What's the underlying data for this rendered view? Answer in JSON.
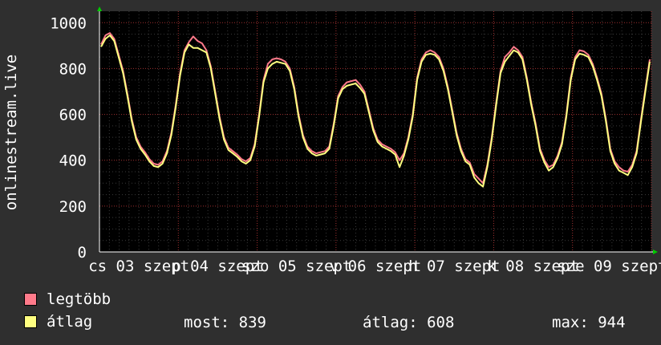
{
  "chart_data": {
    "type": "line",
    "ylabel": "onlinestream.live",
    "ylim": [
      0,
      1050
    ],
    "y_ticks": [
      "0",
      "200",
      "400",
      "600",
      "800",
      "1000"
    ],
    "x_ticks": [
      "cs 03 szept",
      "p 04 szept",
      "szo 05 szept",
      "v 06 szept",
      "h 07 szept",
      "k 08 szept",
      "sze 09 szept"
    ],
    "grid": true,
    "series": [
      {
        "name": "legtöbb",
        "color": "#ff7a8a",
        "values": [
          905,
          945,
          955,
          930,
          860,
          790,
          690,
          580,
          500,
          460,
          435,
          405,
          385,
          380,
          395,
          440,
          520,
          640,
          780,
          880,
          915,
          940,
          920,
          910,
          880,
          810,
          700,
          590,
          500,
          455,
          440,
          425,
          405,
          395,
          410,
          470,
          600,
          750,
          820,
          840,
          845,
          840,
          830,
          800,
          720,
          600,
          510,
          460,
          440,
          430,
          435,
          440,
          460,
          560,
          680,
          720,
          740,
          745,
          750,
          730,
          700,
          620,
          540,
          490,
          470,
          460,
          450,
          435,
          400,
          430,
          500,
          600,
          760,
          840,
          870,
          880,
          870,
          850,
          800,
          720,
          620,
          520,
          450,
          405,
          390,
          340,
          320,
          300,
          380,
          500,
          650,
          790,
          850,
          870,
          895,
          880,
          850,
          760,
          650,
          560,
          450,
          400,
          370,
          380,
          420,
          480,
          600,
          760,
          850,
          880,
          875,
          860,
          820,
          760,
          690,
          580,
          450,
          395,
          370,
          355,
          350,
          380,
          440,
          580,
          710,
          840
        ]
      },
      {
        "name": "átlag",
        "color": "#ffff80",
        "values": [
          895,
          930,
          945,
          920,
          850,
          780,
          680,
          570,
          490,
          450,
          425,
          395,
          375,
          370,
          385,
          430,
          510,
          630,
          770,
          870,
          905,
          890,
          890,
          880,
          870,
          800,
          690,
          580,
          490,
          445,
          430,
          415,
          395,
          385,
          400,
          460,
          590,
          740,
          800,
          820,
          830,
          825,
          820,
          790,
          710,
          590,
          500,
          450,
          430,
          420,
          425,
          430,
          450,
          550,
          670,
          710,
          725,
          730,
          735,
          715,
          690,
          610,
          530,
          480,
          460,
          450,
          440,
          425,
          370,
          420,
          490,
          590,
          750,
          830,
          860,
          865,
          860,
          840,
          790,
          710,
          610,
          510,
          440,
          395,
          380,
          325,
          300,
          285,
          370,
          490,
          640,
          780,
          830,
          855,
          880,
          870,
          840,
          750,
          640,
          550,
          440,
          390,
          355,
          370,
          410,
          470,
          590,
          750,
          840,
          865,
          860,
          850,
          810,
          750,
          680,
          570,
          440,
          385,
          355,
          345,
          335,
          370,
          430,
          570,
          700,
          830
        ]
      }
    ]
  },
  "legend": [
    {
      "label": "legtöbb",
      "color": "#ff7a8a"
    },
    {
      "label": "átlag",
      "color": "#ffff80"
    }
  ],
  "stats": {
    "now": "most: 839",
    "avg": "átlag: 608",
    "max": "max: 944"
  }
}
